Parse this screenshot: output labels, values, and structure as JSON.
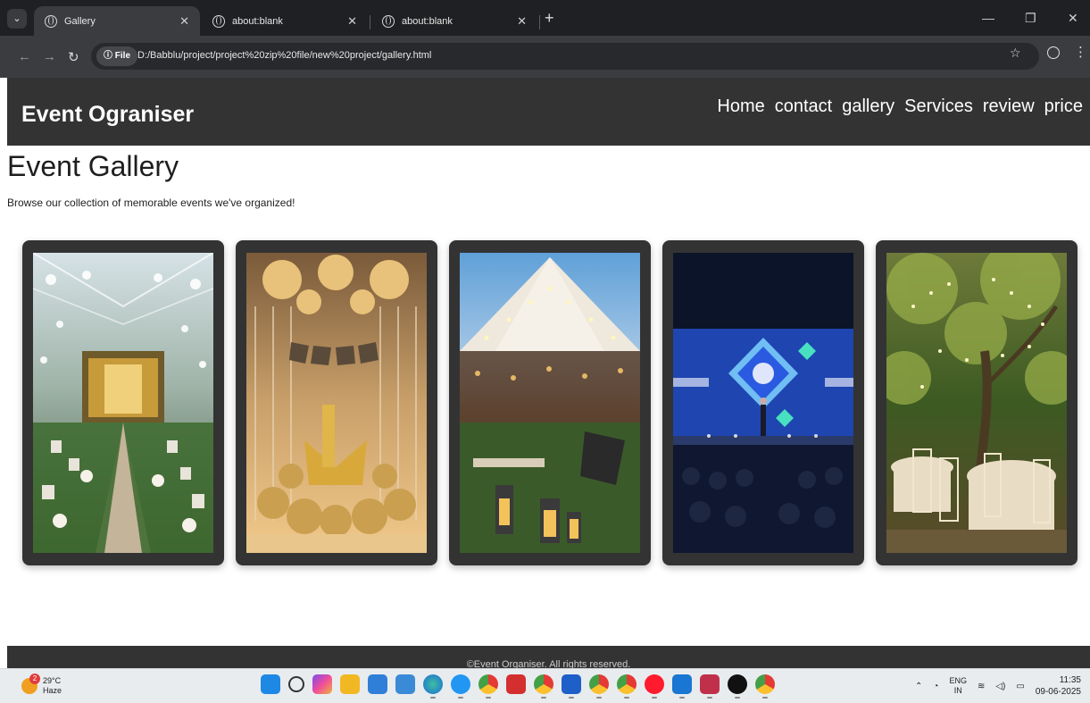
{
  "browser": {
    "tabs": [
      {
        "title": "Gallery",
        "active": true
      },
      {
        "title": "about:blank",
        "active": false
      },
      {
        "title": "about:blank",
        "active": false
      }
    ],
    "address_chip": "File",
    "url": "D:/Babblu/project/project%20zip%20file/new%20project/gallery.html"
  },
  "site": {
    "logo": "Event Ograniser",
    "nav": [
      "Home",
      "contact",
      "gallery",
      "Services",
      "review",
      "price"
    ],
    "gallery_title": "Event Gallery",
    "gallery_subtitle": "Browse our collection of memorable events we've organized!",
    "gallery_images": [
      {
        "alt": "wedding-tent-aisle-photo"
      },
      {
        "alt": "happy-birthday-balloons-photo"
      },
      {
        "alt": "outdoor-tent-dinner-photo"
      },
      {
        "alt": "conference-stage-photo"
      },
      {
        "alt": "garden-fairy-lights-photo"
      }
    ],
    "footer": "©Event Organiser. All rights reserved."
  },
  "taskbar": {
    "weather_temp": "29°C",
    "weather_desc": "Haze",
    "weather_badge": "2",
    "lang_top": "ENG",
    "lang_bottom": "IN",
    "time": "11:35",
    "date": "09-06-2025"
  },
  "colors": {
    "header_bg": "#333333",
    "card_bg": "#333333",
    "browser_tabbar": "#1f2023",
    "browser_toolbar": "#3b3c40"
  }
}
